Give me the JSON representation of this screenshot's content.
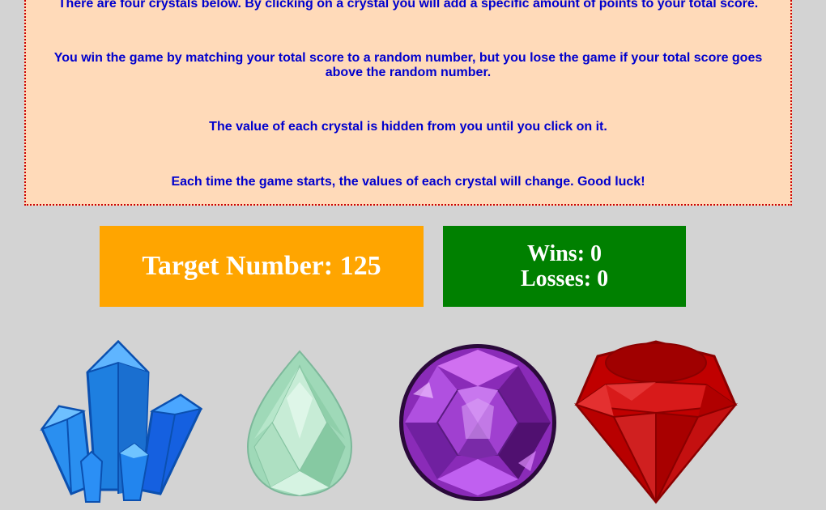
{
  "instructions": {
    "line1": "There are four crystals below. By clicking on a crystal you will add a specific amount of points to your total score.",
    "line2": "You win the game by matching your total score to a random number, but you lose the game if your total score goes above the random number.",
    "line3": "The value of each crystal is hidden from you until you click on it.",
    "line4": "Each time the game starts, the values of each crystal will change. Good luck!"
  },
  "target": {
    "label": "Target Number:",
    "value": "125"
  },
  "record": {
    "wins_label": "Wins:",
    "wins": "0",
    "losses_label": "Losses:",
    "losses": "0"
  },
  "crystals": [
    {
      "name": "blue-crystal-cluster",
      "color": "#1e90ff"
    },
    {
      "name": "green-teardrop-gem",
      "color": "#a8dcc0"
    },
    {
      "name": "purple-round-gem",
      "color": "#9932cc"
    },
    {
      "name": "red-ruby-gem",
      "color": "#cc0000"
    }
  ],
  "colors": {
    "background": "#d3d3d3",
    "instructions_bg": "#ffdab9",
    "instructions_text": "#0000cd",
    "instructions_border": "#cc0000",
    "target_bg": "#ffa500",
    "record_bg": "#008000"
  }
}
